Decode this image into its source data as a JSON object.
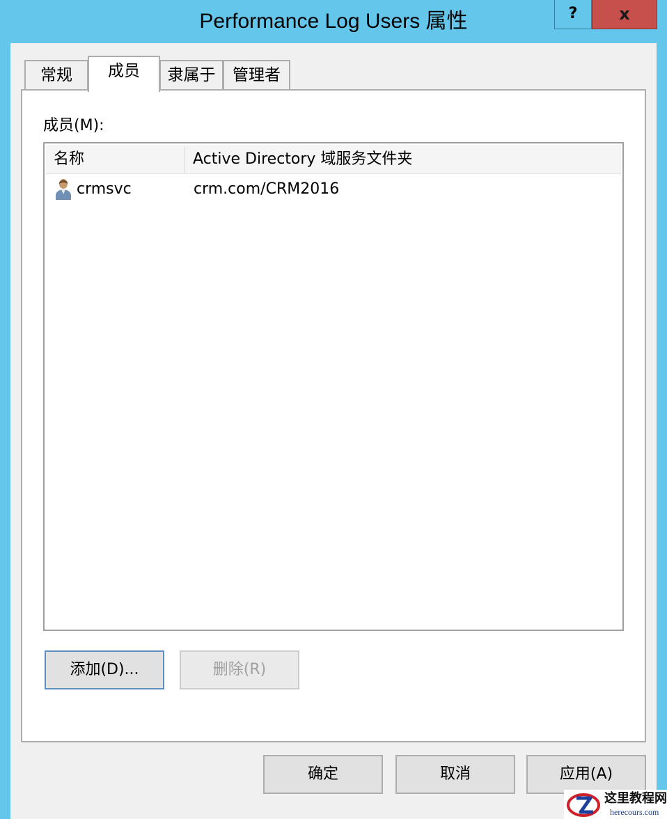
{
  "window": {
    "title": "Performance Log Users 属性",
    "help_label": "?",
    "close_label": "x"
  },
  "tabs": [
    {
      "label": "常规",
      "active": false
    },
    {
      "label": "成员",
      "active": true
    },
    {
      "label": "隶属于",
      "active": false
    },
    {
      "label": "管理者",
      "active": false
    }
  ],
  "members": {
    "label": "成员(M):",
    "columns": [
      "名称",
      "Active Directory 域服务文件夹"
    ],
    "rows": [
      {
        "name": "crmsvc",
        "folder": "crm.com/CRM2016",
        "icon": "user-icon"
      }
    ]
  },
  "actions": {
    "add_label": "添加(D)...",
    "remove_label": "删除(R)"
  },
  "footer": {
    "ok_label": "确定",
    "cancel_label": "取消",
    "apply_label": "应用(A)"
  },
  "watermark": {
    "text": "这里教程网",
    "site": "herecours.com"
  },
  "colors": {
    "title_bar": "#65c6ec",
    "close_button": "#c74f4c",
    "dialog_background": "#f0f0f0",
    "panel_background": "#ffffff"
  }
}
